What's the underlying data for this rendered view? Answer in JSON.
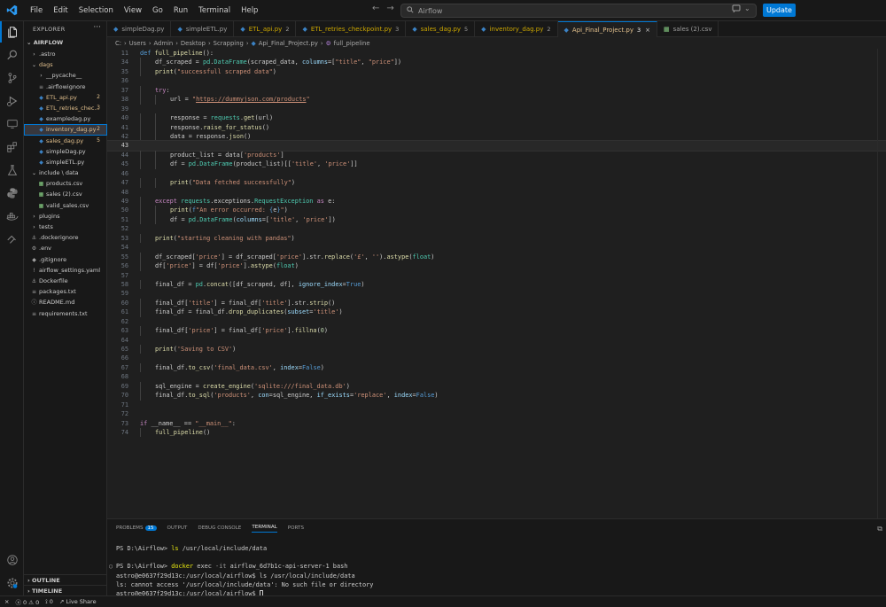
{
  "menu": [
    "File",
    "Edit",
    "Selection",
    "View",
    "Go",
    "Run",
    "Terminal",
    "Help"
  ],
  "command_center": {
    "text": "Airflow"
  },
  "update_label": "Update",
  "sidebar": {
    "title": "EXPLORER",
    "more": "···",
    "root": "AIRFLOW",
    "items": [
      {
        "label": ".astro",
        "kind": "folder",
        "depth": 0,
        "open": false
      },
      {
        "label": "dags",
        "kind": "folder",
        "depth": 0,
        "open": true,
        "color": "#e2c08d"
      },
      {
        "label": "__pycache__",
        "kind": "folder",
        "depth": 1,
        "open": false
      },
      {
        "label": ".airflowignore",
        "kind": "file",
        "depth": 1,
        "icon": "≡"
      },
      {
        "label": "ETL_api.py",
        "kind": "py",
        "depth": 1,
        "badge": "2",
        "color": "#e2c08d"
      },
      {
        "label": "ETL_retries_chec...",
        "kind": "py",
        "depth": 1,
        "badge": "3",
        "color": "#e2c08d"
      },
      {
        "label": "exampledag.py",
        "kind": "py",
        "depth": 1
      },
      {
        "label": "inventory_dag.py",
        "kind": "py",
        "depth": 1,
        "badge": "2",
        "color": "#e2c08d",
        "selected": true
      },
      {
        "label": "sales_dag.py",
        "kind": "py",
        "depth": 1,
        "badge": "5",
        "color": "#e2c08d"
      },
      {
        "label": "simpleDag.py",
        "kind": "py",
        "depth": 1
      },
      {
        "label": "simpleETL.py",
        "kind": "py",
        "depth": 1
      },
      {
        "label": "include \\ data",
        "kind": "folder",
        "depth": 0,
        "open": true
      },
      {
        "label": "products.csv",
        "kind": "csv",
        "depth": 1
      },
      {
        "label": "sales (2).csv",
        "kind": "csv",
        "depth": 1
      },
      {
        "label": "valid_sales.csv",
        "kind": "csv",
        "depth": 1
      },
      {
        "label": "plugins",
        "kind": "folder",
        "depth": 0,
        "open": false
      },
      {
        "label": "tests",
        "kind": "folder",
        "depth": 0,
        "open": false
      },
      {
        "label": ".dockerignore",
        "kind": "file",
        "depth": 0,
        "icon": "⚓"
      },
      {
        "label": ".env",
        "kind": "file",
        "depth": 0,
        "icon": "⚙"
      },
      {
        "label": ".gitignore",
        "kind": "file",
        "depth": 0,
        "icon": "◆"
      },
      {
        "label": "airflow_settings.yaml",
        "kind": "file",
        "depth": 0,
        "icon": "!"
      },
      {
        "label": "Dockerfile",
        "kind": "file",
        "depth": 0,
        "icon": "⚓"
      },
      {
        "label": "packages.txt",
        "kind": "file",
        "depth": 0,
        "icon": "≡"
      },
      {
        "label": "README.md",
        "kind": "file",
        "depth": 0,
        "icon": "ⓘ"
      },
      {
        "label": "requirements.txt",
        "kind": "file",
        "depth": 0,
        "icon": "≡"
      }
    ],
    "outline": "OUTLINE",
    "timeline": "TIMELINE"
  },
  "tabs": [
    {
      "label": "simpleDag.py",
      "badge": "",
      "icon": "py"
    },
    {
      "label": "simpleETL.py",
      "badge": "",
      "icon": "py"
    },
    {
      "label": "ETL_api.py",
      "badge": "2",
      "icon": "py"
    },
    {
      "label": "ETL_retries_checkpoint.py",
      "badge": "3",
      "icon": "py"
    },
    {
      "label": "sales_dag.py",
      "badge": "5",
      "icon": "py"
    },
    {
      "label": "inventory_dag.py",
      "badge": "2",
      "icon": "py"
    },
    {
      "label": "Api_Final_Project.py",
      "badge": "3",
      "icon": "py",
      "active": true
    },
    {
      "label": "sales (2).csv",
      "badge": "",
      "icon": "csv"
    }
  ],
  "breadcrumb": [
    "C:",
    "Users",
    "Admin",
    "Desktop",
    "Scrapping",
    "Api_Final_Project.py",
    "full_pipeline"
  ],
  "current_line": 43,
  "code": [
    {
      "n": 11,
      "indent": 0,
      "t": "<span class='kw'>def</span> <span class='fn'>full_pipeline</span>():"
    },
    {
      "n": 34,
      "indent": 1,
      "t": "df_scraped = <span class='cls'>pd</span>.<span class='cls'>DataFrame</span>(scraped_data, <span class='pr'>columns</span>=[<span class='st'>\"title\"</span>, <span class='st'>\"price\"</span>])"
    },
    {
      "n": 35,
      "indent": 1,
      "t": "<span class='fn'>print</span>(<span class='st'>\"successfull scraped data\"</span>)"
    },
    {
      "n": 36,
      "indent": 0,
      "t": ""
    },
    {
      "n": 37,
      "indent": 1,
      "t": "<span class='kc'>try</span>:"
    },
    {
      "n": 38,
      "indent": 2,
      "t": "url = <span class='st'>\"</span><span class='lk'>https://dummyjson.com/products</span><span class='st'>\"</span>"
    },
    {
      "n": 39,
      "indent": 0,
      "t": ""
    },
    {
      "n": 40,
      "indent": 2,
      "t": "response = <span class='cls'>requests</span>.<span class='fn'>get</span>(url)"
    },
    {
      "n": 41,
      "indent": 2,
      "t": "response.<span class='fn'>raise_for_status</span>()"
    },
    {
      "n": 42,
      "indent": 2,
      "t": "data = response.<span class='fn'>json</span>()"
    },
    {
      "n": 43,
      "indent": 0,
      "t": ""
    },
    {
      "n": 44,
      "indent": 2,
      "t": "product_list = data[<span class='st'>'products'</span>]"
    },
    {
      "n": 45,
      "indent": 2,
      "t": "df = <span class='cls'>pd</span>.<span class='cls'>DataFrame</span>(product_list)[[<span class='st'>'title'</span>, <span class='st'>'price'</span>]]"
    },
    {
      "n": 46,
      "indent": 0,
      "t": ""
    },
    {
      "n": 47,
      "indent": 2,
      "t": "<span class='fn'>print</span>(<span class='st'>\"Data fetched successfully\"</span>)"
    },
    {
      "n": 48,
      "indent": 0,
      "t": ""
    },
    {
      "n": 49,
      "indent": 1,
      "t": "<span class='kc'>except</span> <span class='cls'>requests</span>.exceptions.<span class='cls'>RequestException</span> <span class='kc'>as</span> e:"
    },
    {
      "n": 50,
      "indent": 2,
      "t": "<span class='fn'>print</span>(<span class='kw'>f</span><span class='st'>\"An error occurred: </span><span class='kw'>{</span>e<span class='kw'>}</span><span class='st'>\"</span>)"
    },
    {
      "n": 51,
      "indent": 2,
      "t": "df = <span class='cls'>pd</span>.<span class='cls'>DataFrame</span>(<span class='pr'>columns</span>=[<span class='st'>'title'</span>, <span class='st'>'price'</span>])"
    },
    {
      "n": 52,
      "indent": 0,
      "t": ""
    },
    {
      "n": 53,
      "indent": 1,
      "t": "<span class='fn'>print</span>(<span class='st'>\"starting cleaning with pandas\"</span>)"
    },
    {
      "n": 54,
      "indent": 0,
      "t": ""
    },
    {
      "n": 55,
      "indent": 1,
      "t": "df_scraped[<span class='st'>'price'</span>] = df_scraped[<span class='st'>'price'</span>].str.<span class='fn'>replace</span>(<span class='st'>'£'</span>, <span class='st'>''</span>).<span class='fn'>astype</span>(<span class='cls'>float</span>)"
    },
    {
      "n": 56,
      "indent": 1,
      "t": "df[<span class='st'>'price'</span>] = df[<span class='st'>'price'</span>].<span class='fn'>astype</span>(<span class='cls'>float</span>)"
    },
    {
      "n": 57,
      "indent": 0,
      "t": ""
    },
    {
      "n": 58,
      "indent": 1,
      "t": "final_df = <span class='cls'>pd</span>.<span class='fn'>concat</span>([df_scraped, df], <span class='pr'>ignore_index</span>=<span class='kw'>True</span>)"
    },
    {
      "n": 59,
      "indent": 0,
      "t": ""
    },
    {
      "n": 60,
      "indent": 1,
      "t": "final_df[<span class='st'>'title'</span>] = final_df[<span class='st'>'title'</span>].str.<span class='fn'>strip</span>()"
    },
    {
      "n": 61,
      "indent": 1,
      "t": "final_df = final_df.<span class='fn'>drop_duplicates</span>(<span class='pr'>subset</span>=<span class='st'>'title'</span>)"
    },
    {
      "n": 62,
      "indent": 0,
      "t": ""
    },
    {
      "n": 63,
      "indent": 1,
      "t": "final_df[<span class='st'>'price'</span>] = final_df[<span class='st'>'price'</span>].<span class='fn'>fillna</span>(<span class='nm'>0</span>)"
    },
    {
      "n": 64,
      "indent": 0,
      "t": ""
    },
    {
      "n": 65,
      "indent": 1,
      "t": "<span class='fn'>print</span>(<span class='st'>'Saving to CSV'</span>)"
    },
    {
      "n": 66,
      "indent": 0,
      "t": ""
    },
    {
      "n": 67,
      "indent": 1,
      "t": "final_df.<span class='fn'>to_csv</span>(<span class='st'>'final_data.csv'</span>, <span class='pr'>index</span>=<span class='kw'>False</span>)"
    },
    {
      "n": 68,
      "indent": 0,
      "t": ""
    },
    {
      "n": 69,
      "indent": 1,
      "t": "sql_engine = <span class='fn'>create_engine</span>(<span class='st'>'sqlite:///final_data.db'</span>)"
    },
    {
      "n": 70,
      "indent": 1,
      "t": "final_df.<span class='fn'>to_sql</span>(<span class='st'>'products'</span>, <span class='pr'>con</span>=sql_engine, <span class='pr'>if_exists</span>=<span class='st'>'replace'</span>, <span class='pr'>index</span>=<span class='kw'>False</span>)"
    },
    {
      "n": 71,
      "indent": 0,
      "t": ""
    },
    {
      "n": 72,
      "indent": 0,
      "t": ""
    },
    {
      "n": 73,
      "indent": 0,
      "t": "<span class='kc'>if</span> __name__ == <span class='st'>\"__main__\"</span>:"
    },
    {
      "n": 74,
      "indent": 1,
      "t": "<span class='fn'>full_pipeline</span>()"
    }
  ],
  "panel": {
    "tabs": [
      {
        "label": "PROBLEMS",
        "badge": "15"
      },
      {
        "label": "OUTPUT"
      },
      {
        "label": "DEBUG CONSOLE"
      },
      {
        "label": "TERMINAL",
        "active": true
      },
      {
        "label": "PORTS"
      }
    ],
    "terminal": [
      {
        "dot": false,
        "t": "PS D:\\Airflow> <span class='cmd'>ls</span> /usr/local/include/data"
      },
      {
        "dot": false,
        "t": ""
      },
      {
        "dot": true,
        "t": "PS D:\\Airflow> <span class='cmd'>docker</span> exec <span class='flag'>-it</span> airflow_6d7b1c-api-server-1 bash"
      },
      {
        "dot": false,
        "t": "astro@e0637f29d13c:/usr/local/airflow$ ls /usr/local/include/data"
      },
      {
        "dot": false,
        "t": "ls: cannot access '/usr/local/include/data': No such file or directory"
      },
      {
        "dot": false,
        "t": "astro@e0637f29d13c:/usr/local/airflow$ <span class='cursor'></span>"
      }
    ]
  },
  "status": {
    "errors": "0",
    "warnings": "0",
    "ports": "0",
    "live_share": "Live Share"
  }
}
